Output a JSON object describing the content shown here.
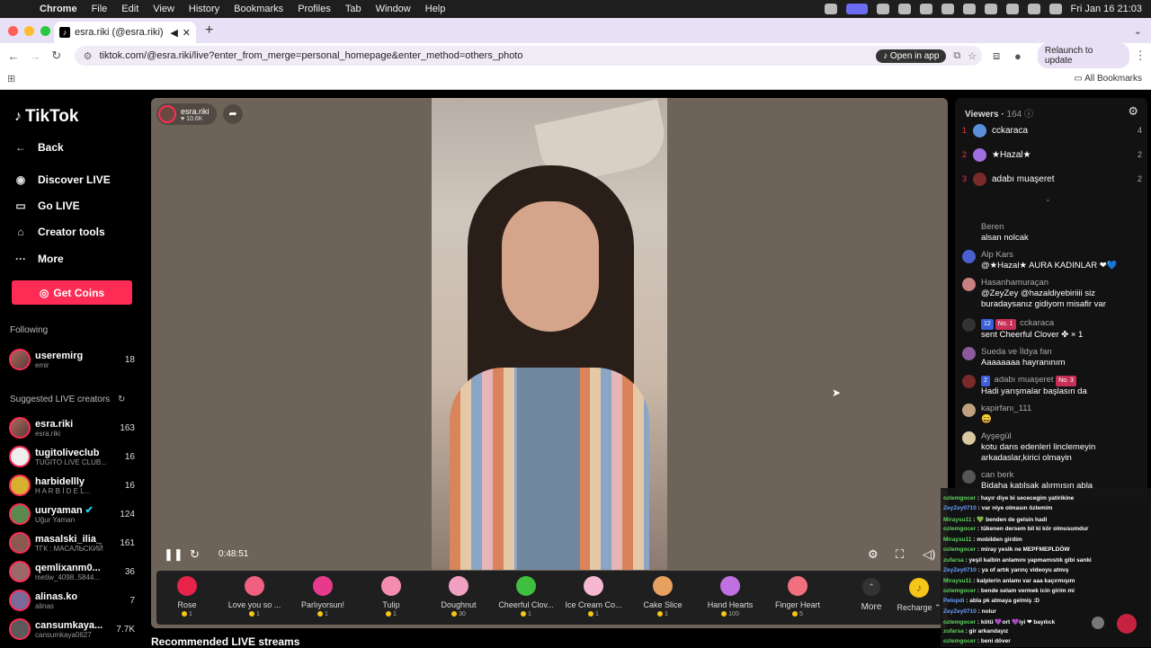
{
  "menubar": {
    "apple": "",
    "items": [
      "Chrome",
      "File",
      "Edit",
      "View",
      "History",
      "Bookmarks",
      "Profiles",
      "Tab",
      "Window",
      "Help"
    ],
    "clock": "Fri Jan 16  21:03"
  },
  "browser": {
    "tab_title": "esra.riki (@esra.riki) is LIVE",
    "url": "tiktok.com/@esra.riki/live?enter_from_merge=personal_homepage&enter_method=others_photo",
    "open_in_app": "Open in app",
    "relaunch": "Relaunch to update",
    "all_bookmarks": "All Bookmarks"
  },
  "sidebar": {
    "logo": "TikTok",
    "back": "Back",
    "nav": [
      {
        "label": "Discover LIVE",
        "icon": "discover-icon"
      },
      {
        "label": "Go LIVE",
        "icon": "video-camera-icon"
      },
      {
        "label": "Creator tools",
        "icon": "home-tools-icon"
      },
      {
        "label": "More",
        "icon": "ellipsis-icon"
      }
    ],
    "get_coins": "Get Coins",
    "following_label": "Following",
    "following": [
      {
        "name": "useremirg",
        "sub": "emir",
        "count": "18"
      }
    ],
    "suggested_label": "Suggested LIVE creators",
    "suggested": [
      {
        "name": "esra.riki",
        "sub": "esra.riki",
        "count": "163"
      },
      {
        "name": "tugitoliveclub",
        "sub": "TUGITO LIVE CLUB...",
        "count": "16"
      },
      {
        "name": "harbidellly",
        "sub": "H A R B İ D E L...",
        "count": "16"
      },
      {
        "name": "uuryaman",
        "sub": "Uğur Yaman",
        "count": "124"
      },
      {
        "name": "masalski_ilia_",
        "sub": "ТГК : МАСАЛЬСКИЙ",
        "count": "161"
      },
      {
        "name": "qemlixanm0...",
        "sub": "metiw_4098..5844...",
        "count": "36"
      },
      {
        "name": "alinas.ko",
        "sub": "alinas",
        "count": "7"
      },
      {
        "name": "cansumkaya...",
        "sub": "cansumkaya0627",
        "count": "7.7K"
      }
    ]
  },
  "stream": {
    "host_name": "esra.riki",
    "host_likes": "10.6K",
    "elapsed": "0:48:51",
    "recommended_title": "Recommended LIVE streams"
  },
  "gifts": [
    {
      "name": "Rose",
      "price": "1",
      "color": "#e8234a"
    },
    {
      "name": "Love you so ...",
      "price": "1",
      "color": "#f06080"
    },
    {
      "name": "Parlıyorsun!",
      "price": "1",
      "color": "#e83a8c"
    },
    {
      "name": "Tulip",
      "price": "1",
      "color": "#f48cb0"
    },
    {
      "name": "Doughnut",
      "price": "30",
      "color": "#f0a0c0"
    },
    {
      "name": "Cheerful Clov...",
      "price": "1",
      "color": "#3fbf3f"
    },
    {
      "name": "Ice Cream Co...",
      "price": "1",
      "color": "#f5b8d0"
    },
    {
      "name": "Cake Slice",
      "price": "1",
      "color": "#e8a060"
    },
    {
      "name": "Hand Hearts",
      "price": "100",
      "color": "#c070e0"
    },
    {
      "name": "Finger Heart",
      "price": "5",
      "color": "#f07080"
    }
  ],
  "gift_more": "More",
  "recharge": "Recharge",
  "viewers": {
    "title": "Viewers",
    "count": "164",
    "top": [
      {
        "rank": "1",
        "name": "cckaraca",
        "score": "4",
        "color": "#5b8fd9"
      },
      {
        "rank": "2",
        "name": "★Hazal★",
        "score": "2",
        "color": "#a070e0"
      },
      {
        "rank": "3",
        "name": "adabı muaşeret",
        "score": "2",
        "color": "#7a2a2a"
      }
    ]
  },
  "chat": [
    {
      "user": "Beren",
      "text": "alsan nolcak",
      "color": "#111"
    },
    {
      "user": "Alp Kars",
      "text": "@★Hazal★ AURA KADINLAR ❤💙",
      "color": "#4a5fd0"
    },
    {
      "user": "Hasanhamuraçan",
      "text": "@ZeyZey @hazaldiyebiriiii siz buradaysanız gidiyom misafir var",
      "color": "#c98080"
    },
    {
      "user": "cckaraca",
      "text": "sent Cheerful Clover ✤ × 1",
      "badge1": "12",
      "badge2": "No. 1",
      "color": "#333"
    },
    {
      "user": "Sueda ve İldya fan",
      "text": "Aaaaaaaa hayranınım",
      "color": "#8a5a9a"
    },
    {
      "user": "adabı muaşeret",
      "text": "Hadi yarışmalar başlasın da",
      "badge1": "2",
      "badge2": "No. 3",
      "color": "#7a2a2a"
    },
    {
      "user": "kapirfanı_111",
      "text": "😄",
      "color": "#c0a080"
    },
    {
      "user": "Ayşegül",
      "text": "kotu dans edenleri linclemeyin arkadaslar,kirici olmayin",
      "color": "#d8c8a0"
    },
    {
      "user": "can berk",
      "text": "Bidaha katılsak alırmısın abla",
      "color": "#555"
    }
  ],
  "overlay_chat": [
    {
      "user": "ozlemgocer",
      "text": "hayır diye bi sececegim yatirikine"
    },
    {
      "user": "ZeyZey0710",
      "text": "var niye olmasın özlemim"
    },
    {
      "user": "Miraysu11",
      "text": "💚 benden de gelsin hadi"
    },
    {
      "user": "ozlemgocer",
      "text": "tükenen dersem bil ki kör olmusumdur"
    },
    {
      "user": "Miraysu11",
      "text": "mobilden girdim"
    },
    {
      "user": "ozlemgocer",
      "text": "miray yeslk ne MEPFMEPLDÖW"
    },
    {
      "user": "zufarsa",
      "text": "yeşil kalbin anlamını yapmamıstık gibi sanki"
    },
    {
      "user": "ZeyZey0710",
      "text": "ya of artık yarınç videoyu atmış"
    },
    {
      "user": "Miraysu11",
      "text": "kalplerin anlamı var aaa kaçırmışım"
    },
    {
      "user": "ozlemgocer",
      "text": "bende selam vermek icin girim mi"
    },
    {
      "user": "Pelopdi",
      "text": "abla pk atmaya gelmiş :D"
    },
    {
      "user": "ZeyZey0710",
      "text": "nolur"
    },
    {
      "user": "ozlemgocer",
      "text": "kötü 💜ort 💜iyi ❤ bayılıck"
    },
    {
      "user": "zufarsa",
      "text": "gir arkandayız"
    },
    {
      "user": "ozlemgocer",
      "text": "beni döver"
    }
  ]
}
